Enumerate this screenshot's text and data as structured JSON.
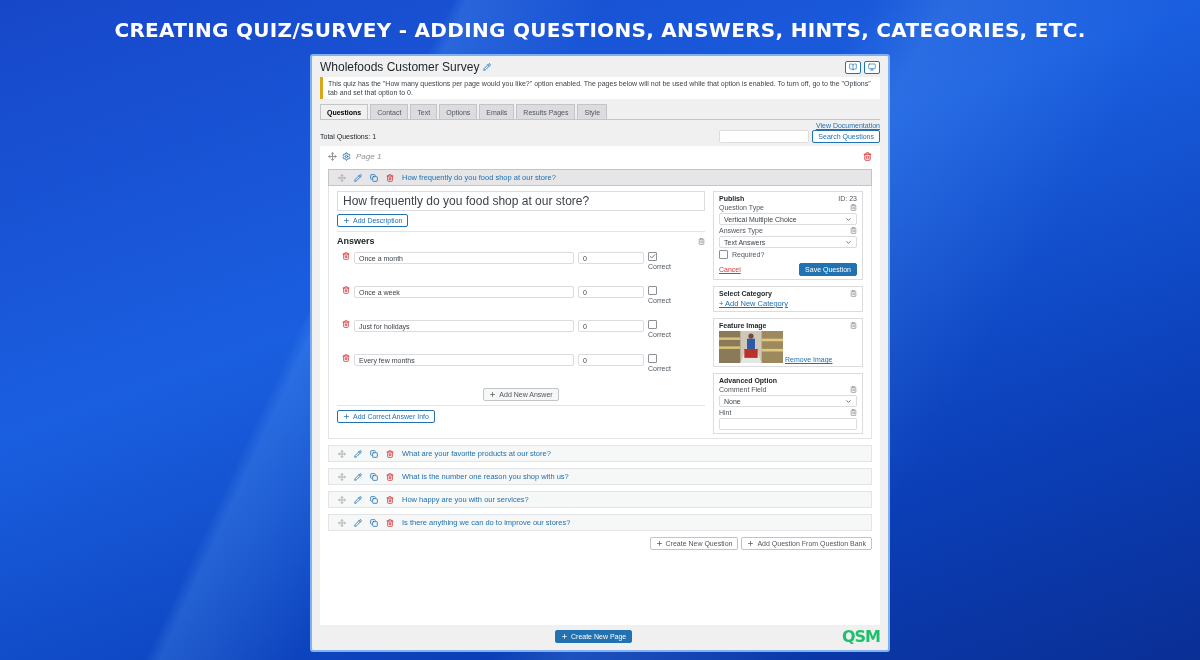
{
  "headline": "CREATING QUIZ/SURVEY - ADDING QUESTIONS, ANSWERS, HINTS, CATEGORIES, ETC.",
  "screen": {
    "title": "Wholefoods Customer Survey",
    "notice": "This quiz has the \"How many questions per page would you like?\" option enabled. The pages below will not be used while that option is enabled. To turn off, go to the \"Options\" tab and set that option to 0.",
    "tabs": [
      {
        "label": "Questions",
        "selected": true
      },
      {
        "label": "Contact",
        "selected": false
      },
      {
        "label": "Text",
        "selected": false
      },
      {
        "label": "Options",
        "selected": false
      },
      {
        "label": "Emails",
        "selected": false
      },
      {
        "label": "Results Pages",
        "selected": false
      },
      {
        "label": "Style",
        "selected": false
      }
    ],
    "documentation_link": "View Documentation",
    "total_questions": "Total Questions: 1",
    "search_button": "Search Questions",
    "page": {
      "title": "Page 1",
      "questions": [
        {
          "title": "How frequently do you food shop at our store?",
          "expanded": true
        },
        {
          "title": "What are your favorite products at our store?",
          "expanded": false
        },
        {
          "title": "What is the number one reason you shop with us?",
          "expanded": false
        },
        {
          "title": "How happy are you with our services?",
          "expanded": false
        },
        {
          "title": "Is there anything we can do to improve our stores?",
          "expanded": false
        }
      ],
      "editor": {
        "question_text": "How frequently do you food shop at our store?",
        "add_description": "Add Description",
        "answers_heading": "Answers",
        "answers": [
          {
            "text": "Once a month",
            "points": "0",
            "checked": true,
            "label": "Correct"
          },
          {
            "text": "Once a week",
            "points": "0",
            "checked": false,
            "label": "Correct"
          },
          {
            "text": "Just for holidays",
            "points": "0",
            "checked": false,
            "label": "Correct"
          },
          {
            "text": "Every few months",
            "points": "0",
            "checked": false,
            "label": "Correct"
          }
        ],
        "add_answer": "Add New Answer",
        "add_correct_info": "Add Correct Answer Info",
        "publish": {
          "title": "Publish",
          "id": "ID: 23",
          "question_type_label": "Question Type",
          "question_type": "Vertical Multiple Choice",
          "answers_type_label": "Answers Type",
          "answers_type": "Text Answers",
          "required_label": "Required?",
          "required": false,
          "cancel": "Cancel",
          "save": "Save Question"
        },
        "category": {
          "title": "Select Category",
          "link": "+ Add New Category"
        },
        "feature_image": {
          "title": "Feature Image",
          "remove": "Remove Image"
        },
        "advanced": {
          "title": "Advanced Option",
          "comment_label": "Comment Field",
          "comment_value": "None",
          "hint_label": "Hint"
        }
      },
      "buttons": [
        "Create New Question",
        "Add Question From Question Bank"
      ]
    },
    "create_page": "Create New Page",
    "logo": "QSM"
  }
}
